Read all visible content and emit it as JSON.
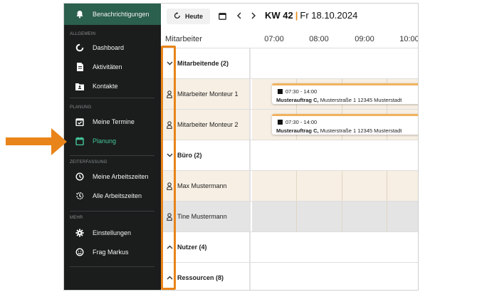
{
  "sidebar": {
    "notifications": "Benachrichtigungen",
    "sections": {
      "general": "ALLGEMEIN",
      "planning": "PLANUNG",
      "time_tracking": "ZEITERFASSUNG",
      "more": "MEHR"
    },
    "items": {
      "dashboard": "Dashboard",
      "activities": "Aktivitäten",
      "contacts": "Kontakte",
      "my_appointments": "Meine Termine",
      "planning": "Planung",
      "my_working_hours": "Meine Arbeitszeiten",
      "all_working_hours": "Alle Arbeitszeiten",
      "settings": "Einstellungen",
      "ask_markus": "Frag Markus"
    },
    "active_item": "planning",
    "accent": "#43c79a"
  },
  "toolbar": {
    "today_label": "Heute",
    "week": "KW 42",
    "date": "Fr 18.10.2024"
  },
  "schedule": {
    "header_title": "Mitarbeiter",
    "hours": [
      "07:00",
      "08:00",
      "09:00",
      "10:00"
    ],
    "rows": [
      {
        "icon": "chevron-down",
        "label": "Mitarbeitende (2)",
        "type": "group"
      },
      {
        "icon": "person",
        "label": "Mitarbeiter Monteur 1",
        "type": "person"
      },
      {
        "icon": "person",
        "label": "Mitarbeiter Monteur 2",
        "type": "person"
      },
      {
        "icon": "chevron-down",
        "label": "Büro (2)",
        "type": "group"
      },
      {
        "icon": "person",
        "label": "Max Mustermann",
        "type": "person"
      },
      {
        "icon": "person",
        "label": "Tine Mustermann",
        "type": "person"
      },
      {
        "icon": "chevron-up",
        "label": "Nutzer (4)",
        "type": "group"
      },
      {
        "icon": "chevron-up",
        "label": "Ressourcen (8)",
        "type": "group"
      }
    ],
    "events": [
      {
        "time": "07:30 - 14:00",
        "title": "Musterauftrag C,",
        "address": "Musterstraße 1 12345 Musterstadt"
      },
      {
        "time": "07:30 - 14:00",
        "title": "Musterauftrag C,",
        "address": "Musterstraße 1 12345 Musterstadt"
      }
    ]
  },
  "colors": {
    "highlight": "#e8841a",
    "sidebar_bg": "#1b1d1d",
    "sidebar_top": "#2b5f4e",
    "workday_bg": "#f7efe3",
    "absent_bg": "#e4e4e4",
    "event_accent": "#f0b25e"
  }
}
